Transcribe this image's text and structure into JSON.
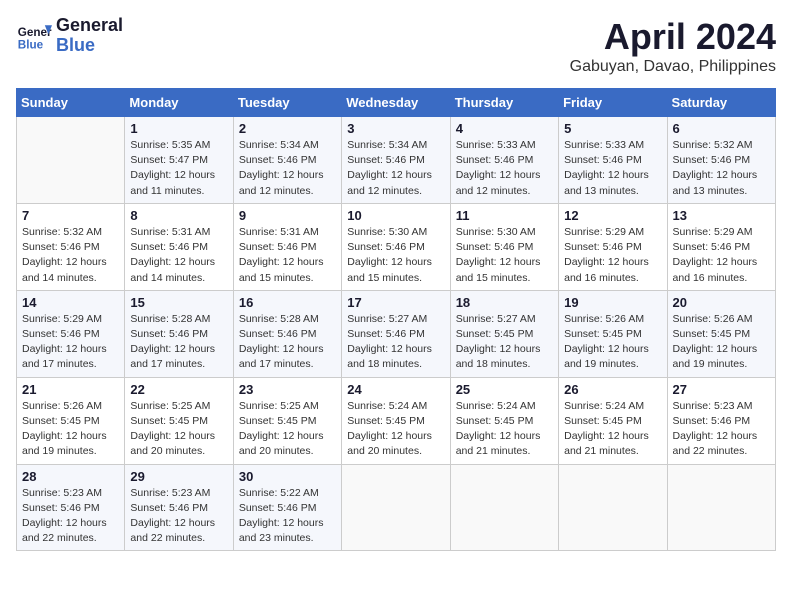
{
  "header": {
    "logo_line1": "General",
    "logo_line2": "Blue",
    "month": "April 2024",
    "location": "Gabuyan, Davao, Philippines"
  },
  "days_of_week": [
    "Sunday",
    "Monday",
    "Tuesday",
    "Wednesday",
    "Thursday",
    "Friday",
    "Saturday"
  ],
  "weeks": [
    [
      {
        "day": "",
        "info": ""
      },
      {
        "day": "1",
        "info": "Sunrise: 5:35 AM\nSunset: 5:47 PM\nDaylight: 12 hours\nand 11 minutes."
      },
      {
        "day": "2",
        "info": "Sunrise: 5:34 AM\nSunset: 5:46 PM\nDaylight: 12 hours\nand 12 minutes."
      },
      {
        "day": "3",
        "info": "Sunrise: 5:34 AM\nSunset: 5:46 PM\nDaylight: 12 hours\nand 12 minutes."
      },
      {
        "day": "4",
        "info": "Sunrise: 5:33 AM\nSunset: 5:46 PM\nDaylight: 12 hours\nand 12 minutes."
      },
      {
        "day": "5",
        "info": "Sunrise: 5:33 AM\nSunset: 5:46 PM\nDaylight: 12 hours\nand 13 minutes."
      },
      {
        "day": "6",
        "info": "Sunrise: 5:32 AM\nSunset: 5:46 PM\nDaylight: 12 hours\nand 13 minutes."
      }
    ],
    [
      {
        "day": "7",
        "info": "Sunrise: 5:32 AM\nSunset: 5:46 PM\nDaylight: 12 hours\nand 14 minutes."
      },
      {
        "day": "8",
        "info": "Sunrise: 5:31 AM\nSunset: 5:46 PM\nDaylight: 12 hours\nand 14 minutes."
      },
      {
        "day": "9",
        "info": "Sunrise: 5:31 AM\nSunset: 5:46 PM\nDaylight: 12 hours\nand 15 minutes."
      },
      {
        "day": "10",
        "info": "Sunrise: 5:30 AM\nSunset: 5:46 PM\nDaylight: 12 hours\nand 15 minutes."
      },
      {
        "day": "11",
        "info": "Sunrise: 5:30 AM\nSunset: 5:46 PM\nDaylight: 12 hours\nand 15 minutes."
      },
      {
        "day": "12",
        "info": "Sunrise: 5:29 AM\nSunset: 5:46 PM\nDaylight: 12 hours\nand 16 minutes."
      },
      {
        "day": "13",
        "info": "Sunrise: 5:29 AM\nSunset: 5:46 PM\nDaylight: 12 hours\nand 16 minutes."
      }
    ],
    [
      {
        "day": "14",
        "info": "Sunrise: 5:29 AM\nSunset: 5:46 PM\nDaylight: 12 hours\nand 17 minutes."
      },
      {
        "day": "15",
        "info": "Sunrise: 5:28 AM\nSunset: 5:46 PM\nDaylight: 12 hours\nand 17 minutes."
      },
      {
        "day": "16",
        "info": "Sunrise: 5:28 AM\nSunset: 5:46 PM\nDaylight: 12 hours\nand 17 minutes."
      },
      {
        "day": "17",
        "info": "Sunrise: 5:27 AM\nSunset: 5:46 PM\nDaylight: 12 hours\nand 18 minutes."
      },
      {
        "day": "18",
        "info": "Sunrise: 5:27 AM\nSunset: 5:45 PM\nDaylight: 12 hours\nand 18 minutes."
      },
      {
        "day": "19",
        "info": "Sunrise: 5:26 AM\nSunset: 5:45 PM\nDaylight: 12 hours\nand 19 minutes."
      },
      {
        "day": "20",
        "info": "Sunrise: 5:26 AM\nSunset: 5:45 PM\nDaylight: 12 hours\nand 19 minutes."
      }
    ],
    [
      {
        "day": "21",
        "info": "Sunrise: 5:26 AM\nSunset: 5:45 PM\nDaylight: 12 hours\nand 19 minutes."
      },
      {
        "day": "22",
        "info": "Sunrise: 5:25 AM\nSunset: 5:45 PM\nDaylight: 12 hours\nand 20 minutes."
      },
      {
        "day": "23",
        "info": "Sunrise: 5:25 AM\nSunset: 5:45 PM\nDaylight: 12 hours\nand 20 minutes."
      },
      {
        "day": "24",
        "info": "Sunrise: 5:24 AM\nSunset: 5:45 PM\nDaylight: 12 hours\nand 20 minutes."
      },
      {
        "day": "25",
        "info": "Sunrise: 5:24 AM\nSunset: 5:45 PM\nDaylight: 12 hours\nand 21 minutes."
      },
      {
        "day": "26",
        "info": "Sunrise: 5:24 AM\nSunset: 5:45 PM\nDaylight: 12 hours\nand 21 minutes."
      },
      {
        "day": "27",
        "info": "Sunrise: 5:23 AM\nSunset: 5:46 PM\nDaylight: 12 hours\nand 22 minutes."
      }
    ],
    [
      {
        "day": "28",
        "info": "Sunrise: 5:23 AM\nSunset: 5:46 PM\nDaylight: 12 hours\nand 22 minutes."
      },
      {
        "day": "29",
        "info": "Sunrise: 5:23 AM\nSunset: 5:46 PM\nDaylight: 12 hours\nand 22 minutes."
      },
      {
        "day": "30",
        "info": "Sunrise: 5:22 AM\nSunset: 5:46 PM\nDaylight: 12 hours\nand 23 minutes."
      },
      {
        "day": "",
        "info": ""
      },
      {
        "day": "",
        "info": ""
      },
      {
        "day": "",
        "info": ""
      },
      {
        "day": "",
        "info": ""
      }
    ]
  ]
}
